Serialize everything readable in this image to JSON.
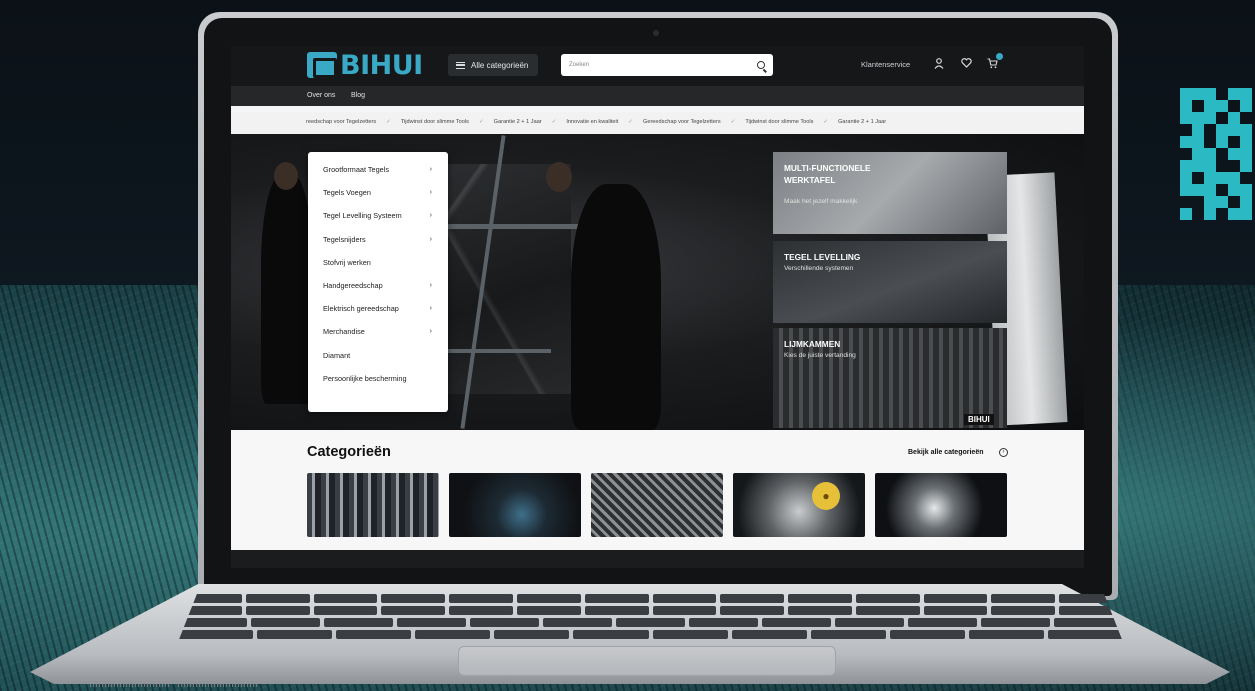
{
  "header": {
    "logo_text": "BIHUI",
    "categories_button": "Alle categorieën",
    "search_placeholder": "Zoeken",
    "customer_service": "Klantenservice"
  },
  "subnav": [
    "Over ons",
    "Blog"
  ],
  "ticker": [
    "reedschap voor Tegelzetters",
    "Tijdwinst door slimme Tools",
    "Garantie 2 + 1 Jaar",
    "Innovatie en kwaliteit",
    "Gereedschap voor Tegelzetters",
    "Tijdwinst door slimme Tools",
    "Garantie 2 + 1 Jaar"
  ],
  "category_menu": [
    {
      "label": "Grootformaat Tegels",
      "has_sub": true
    },
    {
      "label": "Tegels Voegen",
      "has_sub": true
    },
    {
      "label": "Tegel Levelling Systeem",
      "has_sub": true
    },
    {
      "label": "Tegelsnijders",
      "has_sub": true
    },
    {
      "label": "Stofvrij werken",
      "has_sub": false
    },
    {
      "label": "Handgereedschap",
      "has_sub": true
    },
    {
      "label": "Elektrisch gereedschap",
      "has_sub": true
    },
    {
      "label": "Merchandise",
      "has_sub": true
    },
    {
      "label": "Diamant",
      "has_sub": false
    },
    {
      "label": "Persoonlijke bescherming",
      "has_sub": false
    }
  ],
  "promos": [
    {
      "title": "MULTI-FUNCTIONELE WERKTAFEL",
      "subtitle": "Maak het jezelf makkelijk"
    },
    {
      "title": "TEGEL LEVELLING",
      "subtitle": "Verschillende systemen"
    },
    {
      "title": "LIJMKAMMEN",
      "subtitle": "Kies de juiste vertanding"
    }
  ],
  "hero_brand_tag": "BIHUI",
  "categories_section": {
    "title": "Categorieën",
    "see_all": "Bekijk alle categorieën"
  },
  "icons": {
    "account": "user-icon",
    "wishlist": "heart-icon",
    "cart": "cart-icon",
    "chat": "chat-icon"
  },
  "colors": {
    "brand": "#3aa9c5",
    "header_bg": "#151719",
    "chat": "#e7c03a",
    "qr": "#2bb9c4"
  }
}
